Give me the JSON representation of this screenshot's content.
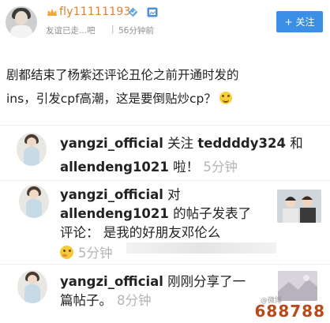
{
  "header": {
    "username": "fly11111193",
    "signature": "友谊已走...吧",
    "separator": "|",
    "time": "56分钟前",
    "follow_label": "关注",
    "follow_plus": "+"
  },
  "post": {
    "line1": "剧都结束了杨紫还评论丑伦之前开通时发的",
    "line2": "ins，引发cpf高潮，这是要倒贴炒cp？"
  },
  "activities": [
    {
      "user": "yangzi_official",
      "text_a": " 关注 ",
      "mention1": "teddddy324",
      "text_b": " 和",
      "mention2": "allendeng1021",
      "text_c": " 啦！",
      "time": "5分钟"
    },
    {
      "user": "yangzi_official",
      "text_a": " 对",
      "mention1": "allendeng1021",
      "text_b": " 的帖子发表了",
      "comment_label": "评论： 是我的好朋友邓伦么",
      "time": "5分钟"
    },
    {
      "user": "yangzi_official",
      "text_a": " 刚刚分享了一",
      "text_b": "篇帖子。",
      "time": "8分钟"
    }
  ],
  "watermark": {
    "text": "688788",
    "small": "@微博"
  },
  "colors": {
    "username": "#e0812c",
    "follow_bg": "#3b8fe5",
    "watermark": "#b84a1a"
  }
}
